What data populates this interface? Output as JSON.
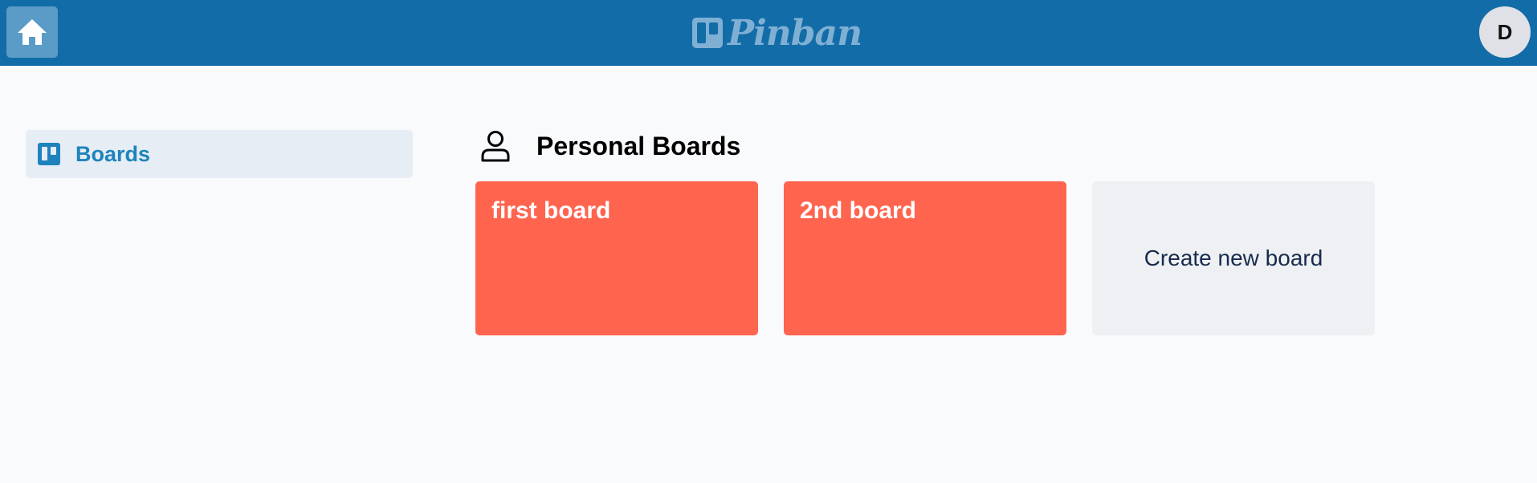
{
  "header": {
    "logo_text": "Pinban",
    "avatar_initial": "D",
    "brand_color": "#126ca7",
    "icons": [
      "home-icon",
      "board-logo-icon"
    ]
  },
  "sidebar": {
    "items": [
      {
        "label": "Boards",
        "icon": "board-icon",
        "active": true
      }
    ]
  },
  "main": {
    "section_title": "Personal Boards",
    "section_icon": "user-icon",
    "boards": [
      {
        "title": "first board",
        "color": "#ff644f"
      },
      {
        "title": "2nd board",
        "color": "#ff644f"
      }
    ],
    "create_label": "Create new board"
  }
}
